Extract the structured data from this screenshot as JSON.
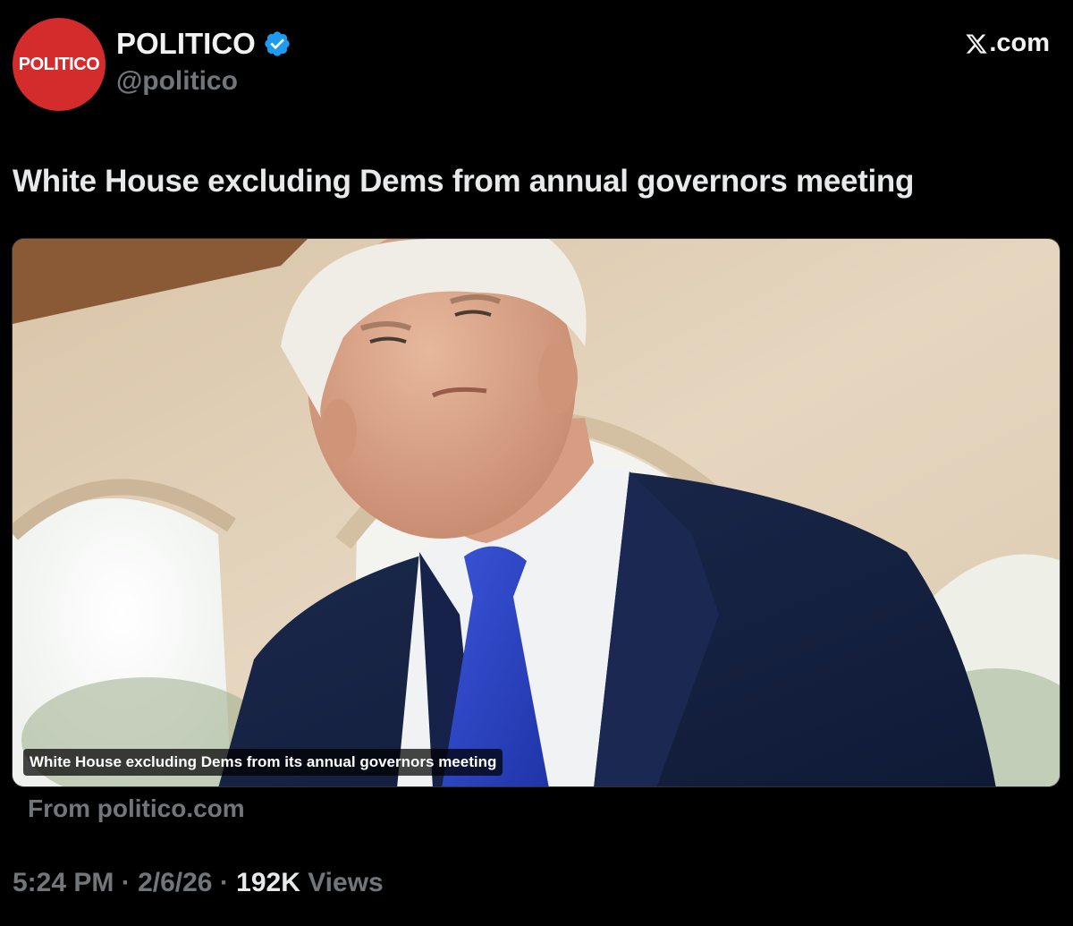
{
  "account": {
    "avatar_text": "POLITICO",
    "display_name": "POLITICO",
    "handle": "@politico",
    "verified": true,
    "avatar_color": "#d42c2c",
    "verified_color": "#1d9bf0"
  },
  "source": {
    "label": ".com",
    "icon": "x-logo-icon"
  },
  "tweet": {
    "text": "White House excluding Dems from annual governors meeting"
  },
  "card": {
    "caption": "White House excluding Dems from its annual governors meeting",
    "domain_text": "From politico.com"
  },
  "meta": {
    "time": "5:24 PM",
    "sep1": " · ",
    "date": "2/6/26",
    "sep2": " · ",
    "views_count": "192K",
    "views_label": " Views"
  }
}
